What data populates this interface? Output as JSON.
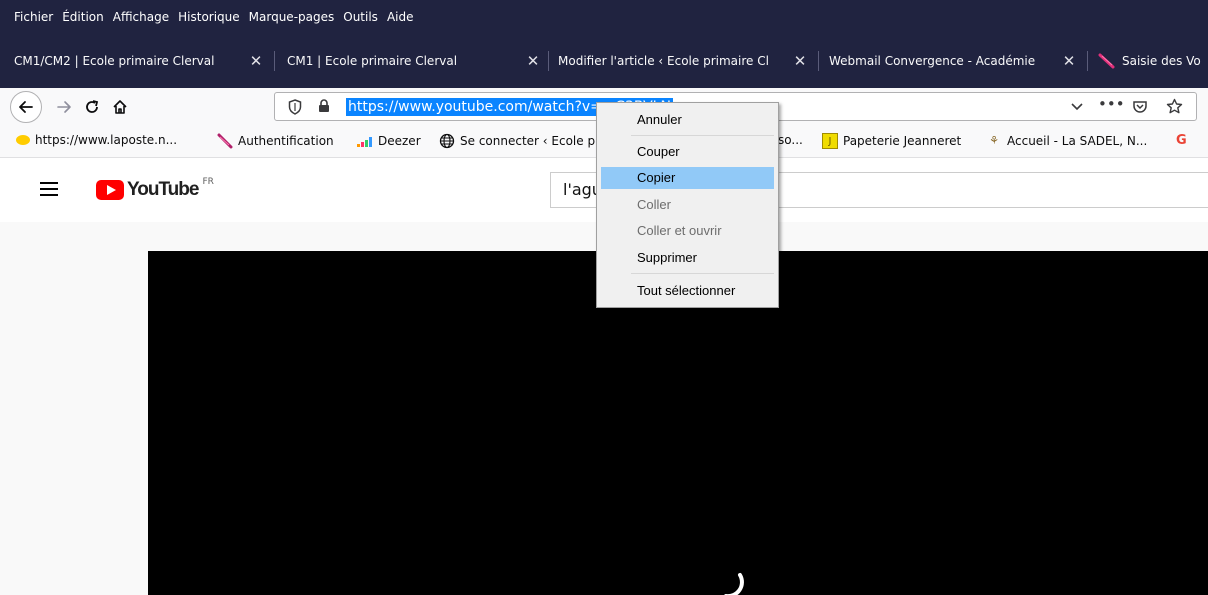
{
  "menubar": {
    "items": [
      "Fichier",
      "Édition",
      "Affichage",
      "Historique",
      "Marque-pages",
      "Outils",
      "Aide"
    ]
  },
  "tabs": [
    {
      "label": "CM1/CM2 | Ecole primaire Clerval"
    },
    {
      "label": "CM1 | Ecole primaire Clerval"
    },
    {
      "label": "Modifier l'article ‹ Ecole primaire Cl"
    },
    {
      "label": "Webmail Convergence - Académie"
    },
    {
      "label": "Saisie des Vo"
    }
  ],
  "navbar": {
    "url_selected": "https://www.youtube.com/watch?v=...C3BVLN",
    "icons": [
      "back-arrow",
      "forward-arrow",
      "reload",
      "home",
      "shield",
      "lock",
      "chevron-down",
      "ellipsis",
      "pocket",
      "star"
    ]
  },
  "bookmarks": [
    {
      "label": "https://www.laposte.n...",
      "icon": "laposte-icon"
    },
    {
      "label": "Authentification",
      "icon": "feather-icon"
    },
    {
      "label": "Deezer",
      "icon": "deezer-icon"
    },
    {
      "label": "Se connecter ‹ Ecole p",
      "icon": "globe-icon"
    },
    {
      "label": "so...",
      "icon": ""
    },
    {
      "label": "Papeterie Jeanneret",
      "icon": "papeterie-icon"
    },
    {
      "label": "Accueil - La SADEL, N...",
      "icon": "sadel-icon"
    },
    {
      "label": "G",
      "icon": "google-icon"
    }
  ],
  "youtube": {
    "logo_text": "YouTube",
    "logo_region": "FR",
    "search_value": "l'agu"
  },
  "context_menu": {
    "items": [
      {
        "label": "Annuler",
        "enabled": true
      },
      {
        "label": "Couper",
        "enabled": true
      },
      {
        "label": "Copier",
        "enabled": true,
        "highlighted": true
      },
      {
        "label": "Coller",
        "enabled": false
      },
      {
        "label": "Coller et ouvrir",
        "enabled": false
      },
      {
        "label": "Supprimer",
        "enabled": true
      },
      {
        "label": "Tout sélectionner",
        "enabled": true
      }
    ]
  },
  "colors": {
    "titlebar": "#202340",
    "selection": "#0a84ff",
    "menu_highlight": "#91c9f7",
    "youtube_red": "#ff0000"
  }
}
